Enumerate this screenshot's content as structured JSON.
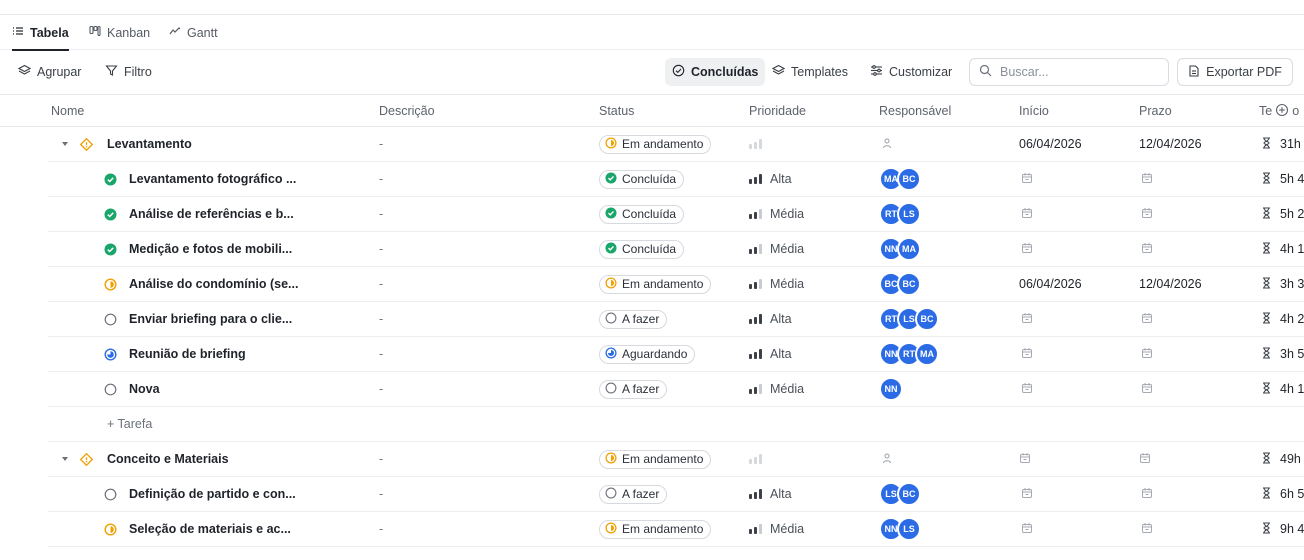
{
  "view_tabs": [
    {
      "label": "Tabela",
      "icon": "list-icon",
      "active": true
    },
    {
      "label": "Kanban",
      "icon": "kanban-icon",
      "active": false
    },
    {
      "label": "Gantt",
      "icon": "gantt-icon",
      "active": false
    }
  ],
  "toolbar": {
    "group_label": "Agrupar",
    "filter_label": "Filtro",
    "completed_label": "Concluídas",
    "templates_label": "Templates",
    "customize_label": "Customizar",
    "search_placeholder": "Buscar...",
    "export_label": "Exportar PDF"
  },
  "columns": {
    "name": "Nome",
    "description": "Descrição",
    "status": "Status",
    "priority": "Prioridade",
    "assignee": "Responsável",
    "start": "Início",
    "due": "Prazo",
    "time": "Te"
  },
  "colors": {
    "accent": "#2b6be6",
    "done": "#1aa66b",
    "in_progress": "#f0a000",
    "waiting": "#2b6be6",
    "todo": "#8a9099",
    "group": "#f0a000"
  },
  "add_task_label": "+ Tarefa",
  "groups": [
    {
      "name": "Levantamento",
      "description": "-",
      "status": "Em andamento",
      "start": "06/04/2026",
      "due": "12/04/2026",
      "time": "31h",
      "tasks": [
        {
          "name": "Levantamento fotográfico ...",
          "description": "-",
          "status": "Concluída",
          "status_key": "done",
          "priority": "Alta",
          "priority_key": "alta",
          "assignees": [
            "MA",
            "BC"
          ],
          "start": "",
          "due": "",
          "time": "5h 4"
        },
        {
          "name": "Análise de referências e b...",
          "description": "-",
          "status": "Concluída",
          "status_key": "done",
          "priority": "Média",
          "priority_key": "media",
          "assignees": [
            "RT",
            "LS"
          ],
          "start": "",
          "due": "",
          "time": "5h 2"
        },
        {
          "name": "Medição e fotos de mobili...",
          "description": "-",
          "status": "Concluída",
          "status_key": "done",
          "priority": "Média",
          "priority_key": "media",
          "assignees": [
            "NN",
            "MA"
          ],
          "start": "",
          "due": "",
          "time": "4h 1"
        },
        {
          "name": "Análise do condomínio (se...",
          "description": "-",
          "status": "Em andamento",
          "status_key": "progress",
          "priority": "Média",
          "priority_key": "media",
          "assignees": [
            "BC",
            "BC"
          ],
          "start": "06/04/2026",
          "due": "12/04/2026",
          "time": "3h 3"
        },
        {
          "name": "Enviar briefing para o clie...",
          "description": "-",
          "status": "A fazer",
          "status_key": "todo",
          "priority": "Alta",
          "priority_key": "alta",
          "assignees": [
            "RT",
            "LS",
            "BC"
          ],
          "start": "",
          "due": "",
          "time": "4h 2"
        },
        {
          "name": "Reunião de briefing",
          "description": "-",
          "status": "Aguardando",
          "status_key": "waiting",
          "priority": "Alta",
          "priority_key": "alta",
          "assignees": [
            "NN",
            "RT",
            "MA"
          ],
          "start": "",
          "due": "",
          "time": "3h 5"
        },
        {
          "name": "Nova",
          "description": "-",
          "status": "A fazer",
          "status_key": "todo",
          "priority": "Média",
          "priority_key": "media",
          "assignees": [
            "NN"
          ],
          "start": "",
          "due": "",
          "time": "4h 1"
        }
      ]
    },
    {
      "name": "Conceito e Materiais",
      "description": "-",
      "status": "Em andamento",
      "start": "",
      "due": "",
      "time": "49h",
      "tasks": [
        {
          "name": "Definição de partido e con...",
          "description": "-",
          "status": "A fazer",
          "status_key": "todo",
          "priority": "Alta",
          "priority_key": "alta",
          "assignees": [
            "LS",
            "BC"
          ],
          "start": "",
          "due": "",
          "time": "6h 5"
        },
        {
          "name": "Seleção de materiais e ac...",
          "description": "-",
          "status": "Em andamento",
          "status_key": "progress",
          "priority": "Média",
          "priority_key": "media",
          "assignees": [
            "NN",
            "LS"
          ],
          "start": "",
          "due": "",
          "time": "9h 4"
        }
      ]
    }
  ]
}
